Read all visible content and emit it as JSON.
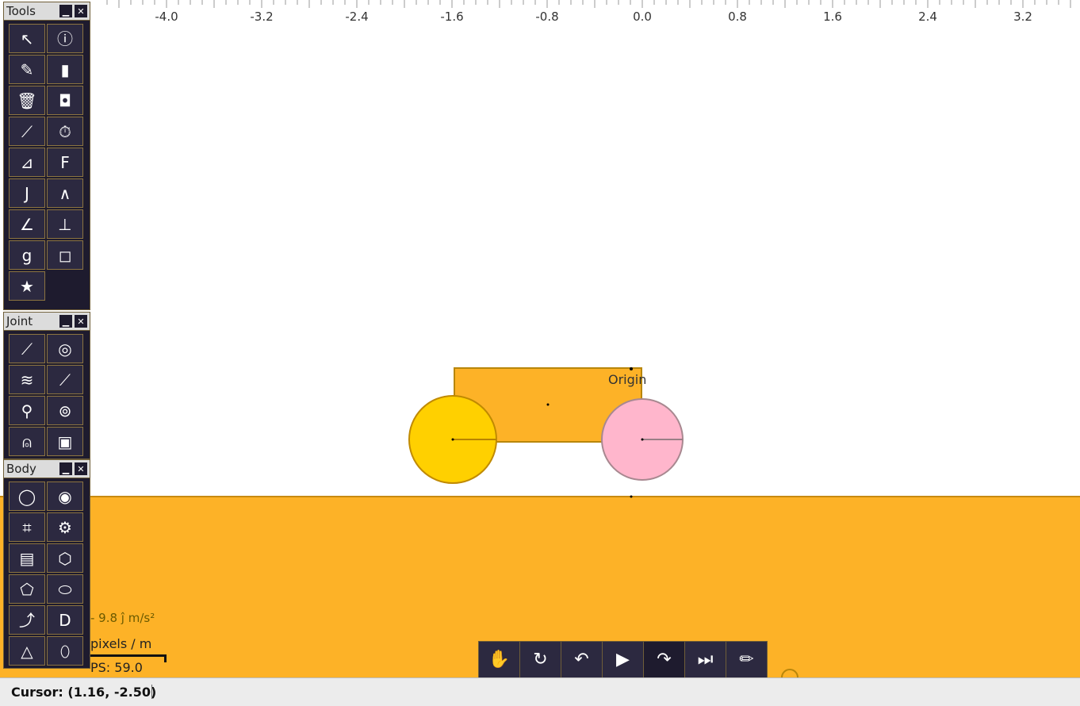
{
  "ruler": {
    "ticks": [
      "-4.0",
      "-3.2",
      "-2.4",
      "-1.6",
      "-0.8",
      "0.0",
      "0.8",
      "1.6",
      "2.4",
      "3.2"
    ]
  },
  "scene": {
    "origin_label": "Origin",
    "colors": {
      "ground": "#FDB227",
      "chassis": "#FDB227",
      "wheel_left": "#FFD000",
      "wheel_right": "#FFB6CC"
    }
  },
  "panels": {
    "tools": {
      "title": "Tools",
      "minimize_icon": "minimize-icon",
      "close_icon": "close-icon",
      "items": [
        {
          "name": "select-tool",
          "glyph": "↖"
        },
        {
          "name": "info-tool",
          "glyph": "ⓘ"
        },
        {
          "name": "pen-tool",
          "glyph": "✎"
        },
        {
          "name": "mouse-tool",
          "glyph": "▮"
        },
        {
          "name": "delete-tool",
          "glyph": "🗑"
        },
        {
          "name": "camera-tool",
          "glyph": "◘"
        },
        {
          "name": "graph-tool",
          "glyph": "⟋"
        },
        {
          "name": "timer-tool",
          "glyph": "⏱"
        },
        {
          "name": "vector-tool",
          "glyph": "⊿"
        },
        {
          "name": "force-tool",
          "glyph": "F"
        },
        {
          "name": "impulse-tool",
          "glyph": "J"
        },
        {
          "name": "trajectory-tool",
          "glyph": "∧"
        },
        {
          "name": "angle-tool",
          "glyph": "∠"
        },
        {
          "name": "axes-tool",
          "glyph": "⊥"
        },
        {
          "name": "gravity-tool",
          "glyph": "g"
        },
        {
          "name": "shapes-tool",
          "glyph": "◻"
        },
        {
          "name": "star-tool",
          "glyph": "★"
        }
      ]
    },
    "joint": {
      "title": "Joint",
      "items": [
        {
          "name": "distance-joint",
          "glyph": "⟋"
        },
        {
          "name": "revolute-joint",
          "glyph": "◎"
        },
        {
          "name": "spring-joint",
          "glyph": "≋"
        },
        {
          "name": "rope-joint",
          "glyph": "⟋"
        },
        {
          "name": "pulley-joint",
          "glyph": "⚲"
        },
        {
          "name": "motor-joint",
          "glyph": "⊚"
        },
        {
          "name": "wheel-joint",
          "glyph": "⍝"
        },
        {
          "name": "weld-joint",
          "glyph": "▣"
        }
      ]
    },
    "body": {
      "title": "Body",
      "items": [
        {
          "name": "circle-body",
          "glyph": "◯"
        },
        {
          "name": "ring-body",
          "glyph": "◉"
        },
        {
          "name": "box-body",
          "glyph": "⌗"
        },
        {
          "name": "gear-body",
          "glyph": "⚙"
        },
        {
          "name": "wall-body",
          "glyph": "▤"
        },
        {
          "name": "polygon-body",
          "glyph": "⬡"
        },
        {
          "name": "quad-body",
          "glyph": "⬠"
        },
        {
          "name": "blob-body",
          "glyph": "⬭"
        },
        {
          "name": "curve-body",
          "glyph": "⤴"
        },
        {
          "name": "semicircle-body",
          "glyph": "D"
        },
        {
          "name": "triangle-body",
          "glyph": "△"
        },
        {
          "name": "capsule-body",
          "glyph": "⬯"
        }
      ]
    }
  },
  "overlay": {
    "gravity": "- 9.8 ĵ m/s²",
    "scale": "pixels / m",
    "fps": "PS: 59.0"
  },
  "playbar": {
    "items": [
      {
        "name": "hand-button",
        "glyph": "✋"
      },
      {
        "name": "reset-button",
        "glyph": "↻"
      },
      {
        "name": "undo-button",
        "glyph": "↶"
      },
      {
        "name": "play-button",
        "glyph": "▶"
      },
      {
        "name": "redo-button",
        "glyph": "↷"
      },
      {
        "name": "step-button",
        "glyph": "⏭"
      },
      {
        "name": "edit-button",
        "glyph": "✏"
      }
    ]
  },
  "status": {
    "cursor": "Cursor: (1.16, -2.50)"
  }
}
